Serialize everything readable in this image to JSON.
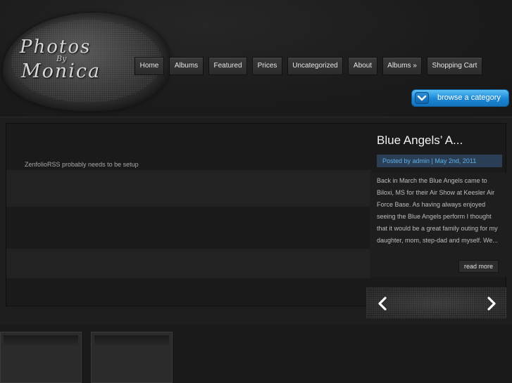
{
  "logo": {
    "line1": "Photos",
    "line2": "By",
    "line3": "Monica",
    "logo_icon": "photos-by-monica-logo"
  },
  "nav": {
    "items": [
      {
        "label": "Home"
      },
      {
        "label": "Albums"
      },
      {
        "label": "Featured"
      },
      {
        "label": "Prices"
      },
      {
        "label": "Uncategorized"
      },
      {
        "label": "About"
      },
      {
        "label": "Albums »"
      },
      {
        "label": "Shopping Cart"
      }
    ]
  },
  "browse": {
    "label": "browse a category",
    "icon": "chevron-down-icon",
    "color": "#1a87d5"
  },
  "slider": {
    "message": "ZenfolioRSS probably needs to be setup"
  },
  "post": {
    "title": "Blue Angels’ A...",
    "meta": "Posted by admin | May 2nd, 2011",
    "excerpt": "Back in March the Blue Angels came to Biloxi, MS for their Air Show at Keesler Air Force Base. As having always enjoyed seeing the Blue Angels perform I thought that it would be a great family outing for my daughter, mom, step-dad and myself. We...",
    "read_more": "read more",
    "meta_color": "#5fb0e8"
  },
  "arrows": {
    "prev_icon": "arrow-left-icon",
    "next_icon": "arrow-right-icon"
  }
}
